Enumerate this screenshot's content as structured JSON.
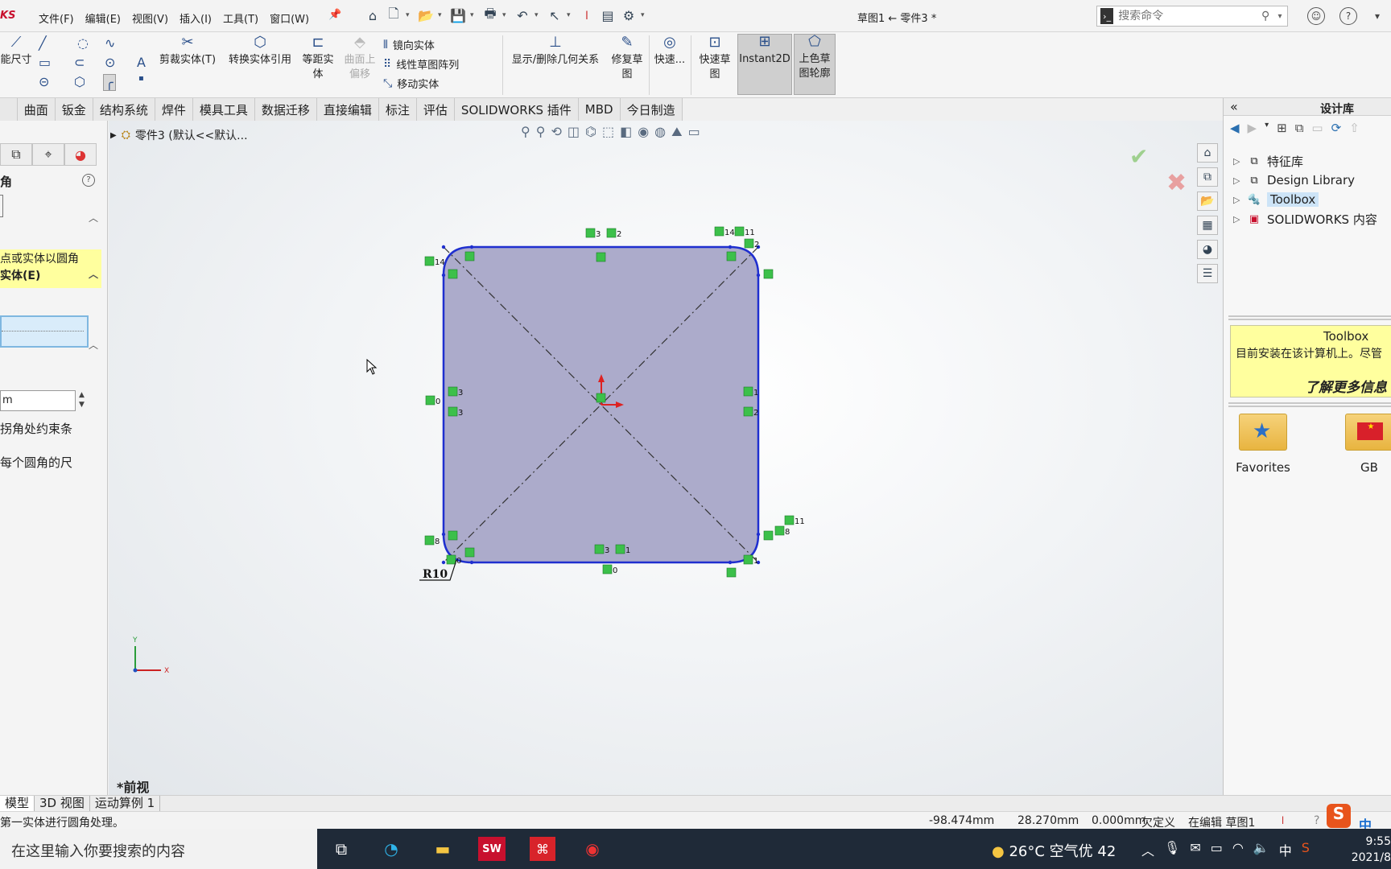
{
  "app": {
    "brand": "KS",
    "menus": [
      "文件(F)",
      "编辑(E)",
      "视图(V)",
      "插入(I)",
      "工具(T)",
      "窗口(W)"
    ],
    "doc_title": "草图1 ← 零件3 *",
    "search_placeholder": "搜索命令"
  },
  "ribbon": {
    "smart_dim": "能尺寸",
    "trim": "剪裁实体(T)",
    "convert": "转换实体引用",
    "offset_l1": "等距实",
    "offset_l2": "体",
    "surf_offset_l1": "曲面上",
    "surf_offset_l2": "偏移",
    "mirror": "镜向实体",
    "linear_pattern": "线性草图阵列",
    "move": "移动实体",
    "show_delete": "显示/删除几何关系",
    "repair_l1": "修复草",
    "repair_l2": "图",
    "quick_snap": "快速...",
    "rapid_l1": "快速草",
    "rapid_l2": "图",
    "instant2d": "Instant2D",
    "shaded_l1": "上色草",
    "shaded_l2": "图轮廓"
  },
  "tabs": [
    "",
    "曲面",
    "钣金",
    "结构系统",
    "焊件",
    "模具工具",
    "数据迁移",
    "直接编辑",
    "标注",
    "评估",
    "SOLIDWORKS 插件",
    "MBD",
    "今日制造"
  ],
  "left_panel": {
    "title": "角",
    "yellow_msg_l1": "点或实体以圆角",
    "section_entities": "实体(E)",
    "radius_value": "m",
    "opt1": "拐角处约束条",
    "opt2": "每个圆角的尺"
  },
  "graphics": {
    "tree_label": "零件3  (默认<<默认...",
    "view_label": "*前视",
    "radius_label": "R10",
    "axis_x": "X",
    "axis_y": "Y",
    "relation_labels": [
      "3",
      "2",
      "14",
      "11",
      "2",
      "14",
      "0",
      "3",
      "3",
      "1",
      "2",
      "8",
      "0",
      "3",
      "1",
      "0",
      "1",
      "11",
      "8"
    ]
  },
  "design_library": {
    "title": "设计库",
    "tree": [
      {
        "label": "特征库",
        "icon": "feature-library-icon"
      },
      {
        "label": "Design Library",
        "icon": "design-library-icon"
      },
      {
        "label": "Toolbox",
        "icon": "toolbox-icon",
        "selected": true
      },
      {
        "label": "SOLIDWORKS 内容",
        "icon": "solidworks-content-icon"
      }
    ],
    "info_title": "Toolbox",
    "info_desc": "目前安装在该计算机上。尽管",
    "info_more": "了解更多信息",
    "folders": [
      "Favorites",
      "GB"
    ]
  },
  "bottom_tabs": [
    "模型",
    "3D 视图",
    "运动算例 1"
  ],
  "status": {
    "msg": "第一实体进行圆角处理。",
    "x": "-98.474mm",
    "y": "28.270mm",
    "z": "0.000mm",
    "state": "欠定义",
    "mode": "在编辑 草图1"
  },
  "taskbar": {
    "search": "在这里输入你要搜索的内容",
    "weather": "26°C 空气优 42",
    "ime": "中",
    "time": "9:55",
    "date": "2021/8"
  },
  "colors": {
    "sketch_fill": "#a8a6c8",
    "sketch_line": "#1f2fcf",
    "relation_green": "#3cc04a",
    "highlight_yellow": "#ffff9e"
  }
}
